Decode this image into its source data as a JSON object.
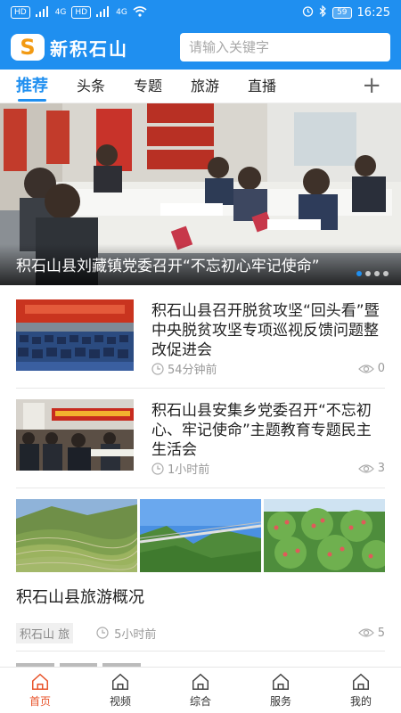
{
  "status_bar": {
    "hd1": "HD",
    "sig1": "4G",
    "hd2": "HD",
    "sig2": "4G",
    "battery": "59",
    "time": "16:25"
  },
  "header": {
    "logo_mark": "S",
    "logo_text": "新积石山",
    "search_placeholder": "请输入关键字"
  },
  "tabs": [
    {
      "label": "推荐",
      "active": true
    },
    {
      "label": "头条"
    },
    {
      "label": "专题"
    },
    {
      "label": "旅游"
    },
    {
      "label": "直播"
    }
  ],
  "tab_add": "+",
  "banner": {
    "caption": "积石山县刘藏镇党委召开“不忘初心牢记使命”"
  },
  "news": [
    {
      "title": "积石山县召开脱贫攻坚“回头看”暨中央脱贫攻坚专项巡视反馈问题整改促进会",
      "time": "54分钟前",
      "views": "0"
    },
    {
      "title": "积石山县安集乡党委召开“不忘初心、牢记使命”主题教育专题民主生活会",
      "time": "1小时前",
      "views": "3"
    }
  ],
  "tour": {
    "title": "积石山县旅游概况",
    "tag": "积石山 旅",
    "time": "5小时前",
    "views": "5"
  },
  "bottom_nav": [
    {
      "label": "首页",
      "active": true
    },
    {
      "label": "视频"
    },
    {
      "label": "综合"
    },
    {
      "label": "服务"
    },
    {
      "label": "我的"
    }
  ],
  "colors": {
    "brand_blue": "#1f8ff0",
    "nav_active": "#e8532a"
  }
}
